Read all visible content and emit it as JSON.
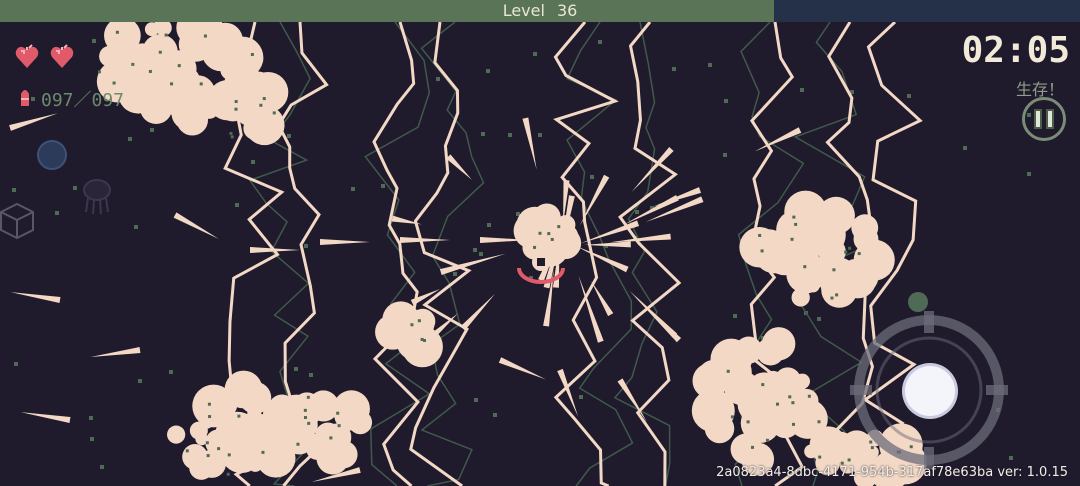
{
  "hud": {
    "level_label": "Level",
    "level_value": "36",
    "xp_progress": 0.717,
    "health": {
      "hearts": 2,
      "icon": "heart-icon"
    },
    "ammo": {
      "icon": "bullet-icon",
      "text": "097／097"
    },
    "timer": "02:05",
    "objective": "生存！",
    "pause_icon": "pause-icon"
  },
  "build_info": "2a0823a4-8dbc-4171-954b-317af78e63ba ver: 1.0.15",
  "colors": {
    "background": "#1f1a2c",
    "xp_fill": "#5a7458",
    "xp_track": "#243149",
    "heart": "#e05a6a",
    "lightning": "#f2d8c5",
    "bullet": "#f2d8c5",
    "explosion": "#f2d8c5",
    "accent_green": "#6c8a6e"
  }
}
